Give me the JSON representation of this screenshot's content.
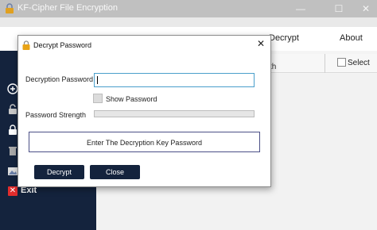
{
  "window": {
    "title": "KF-Cipher File Encryption",
    "icon": "app-lock-icon",
    "controls": {
      "minimize": "—",
      "maximize": "☐",
      "close": "✕"
    }
  },
  "menu": {
    "items": [
      {
        "label": "Decrypt"
      },
      {
        "label": "About"
      }
    ]
  },
  "sidebar": {
    "icons": [
      "add-icon",
      "lock-icon",
      "unlock-icon",
      "trash-icon",
      "image-icon"
    ],
    "exit_label": "Exit"
  },
  "panel": {
    "path_header_partial": "th",
    "select_label": "Select"
  },
  "dialog": {
    "title": "Decrypt Password",
    "close": "✕",
    "password_label": "Decryption Password",
    "password_value": "",
    "show_password_label": "Show Password",
    "show_password_checked": false,
    "strength_label": "Password Strength",
    "strength_value": 0,
    "hint": "Enter The Decryption Key Password",
    "decrypt_label": "Decrypt",
    "close_label": "Close"
  },
  "colors": {
    "sidebar": "#14233d",
    "button": "#14233d",
    "input_focus": "#4a9fcb",
    "exit": "#e22d2d"
  }
}
